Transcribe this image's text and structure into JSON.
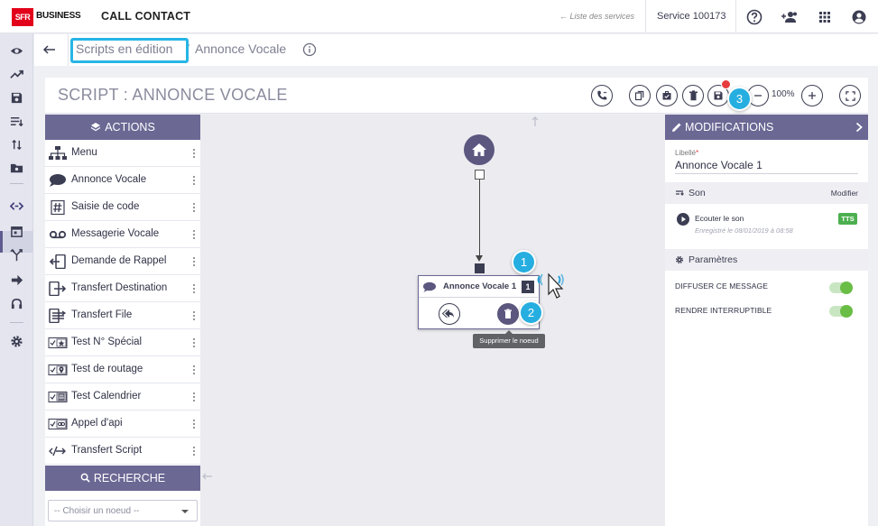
{
  "topbar": {
    "logo_sfr": "SFR",
    "logo_business": "BUSINESS",
    "app_title": "CALL CONTACT",
    "services_link": "← Liste des services",
    "service_label": "Service 100173",
    "icons": [
      "help-icon",
      "users-icon",
      "apps-grid-icon",
      "account-icon"
    ]
  },
  "rail": {
    "icons": [
      "eye-icon",
      "chart-icon",
      "save-icon",
      "list-icon",
      "sort-icon",
      "folder-icon",
      "code-icon",
      "calendar-icon",
      "branch-icon",
      "arrow-right-icon",
      "headset-icon",
      "gear-icon"
    ],
    "active": "code-icon"
  },
  "breadcrumb": {
    "parent": "Scripts en édition",
    "separator": "/",
    "current": "Annonce Vocale"
  },
  "script": {
    "title": "SCRIPT : ANNONCE VOCALE",
    "zoom": "100%"
  },
  "actions": {
    "header": "ACTIONS",
    "items": [
      {
        "label": "Menu",
        "icon": "sitemap-icon"
      },
      {
        "label": "Annonce Vocale",
        "icon": "chat-icon"
      },
      {
        "label": "Saisie de code",
        "icon": "hash-icon"
      },
      {
        "label": "Messagerie Vocale",
        "icon": "voicemail-icon"
      },
      {
        "label": "Demande de Rappel",
        "icon": "callback-icon"
      },
      {
        "label": "Transfert Destination",
        "icon": "transfer-icon"
      },
      {
        "label": "Transfert File",
        "icon": "queue-icon"
      },
      {
        "label": "Test N° Spécial",
        "icon": "check-star-icon"
      },
      {
        "label": "Test de routage",
        "icon": "check-pin-icon"
      },
      {
        "label": "Test Calendrier",
        "icon": "check-calendar-icon"
      },
      {
        "label": "Appel d'api",
        "icon": "check-link-icon"
      },
      {
        "label": "Transfert Script",
        "icon": "script-transfer-icon"
      }
    ],
    "search_header": "RECHERCHE",
    "select_placeholder": "-- Choisir un noeud --"
  },
  "canvas": {
    "node_title": "Annonce Vocale 1",
    "node_count": "1",
    "tooltip": "Supprimer le noeud",
    "steps": [
      "1",
      "2",
      "3"
    ]
  },
  "modifications": {
    "header": "MODIFICATIONS",
    "libelle_label": "Libellé",
    "libelle_required": "*",
    "libelle_value": "Annonce Vocale 1",
    "son_title": "Son",
    "son_modifier": "Modifier",
    "ecouter": "Ecouter le son",
    "saved_date": "Enregistré le 08/01/2019 à 08:58",
    "tts": "TTS",
    "params_title": "Paramètres",
    "toggles": [
      {
        "label": "DIFFUSER CE MESSAGE",
        "on": true
      },
      {
        "label": "RENDRE INTERRUPTIBLE",
        "on": true
      }
    ]
  },
  "colors": {
    "accent": "#6b6894",
    "dark": "#3b3d52",
    "highlight": "#27b5e5",
    "brand": "#e2001a",
    "toggle_on": "#6abd45"
  }
}
